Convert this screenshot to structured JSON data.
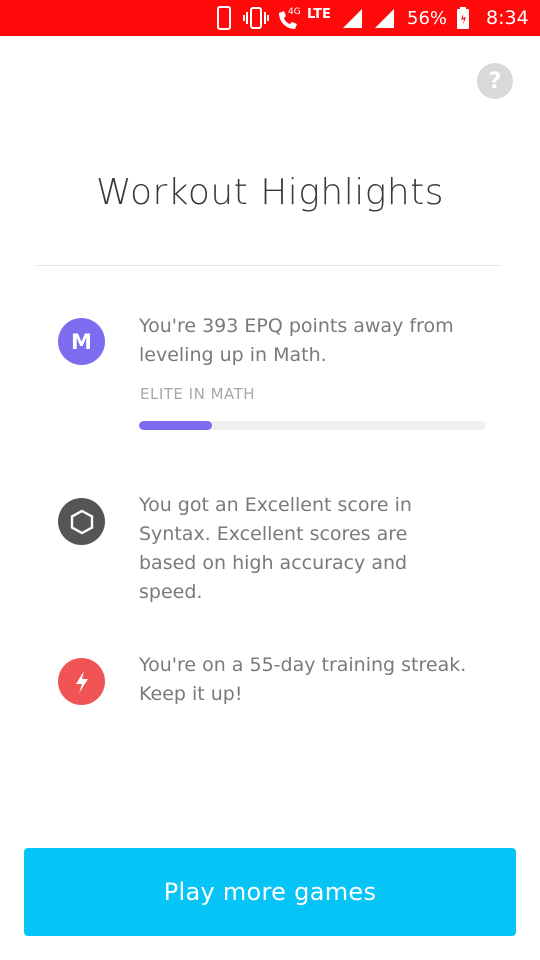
{
  "status_bar": {
    "lte": "LTE",
    "network_badge": "4G",
    "battery": "56%",
    "time": "8:34"
  },
  "help": {
    "icon": "question-icon",
    "label": "?"
  },
  "title": "Workout Highlights",
  "highlights": [
    {
      "icon_letter": "M",
      "icon_color": "#7b6cf0",
      "text": "You're 393 EPQ points away from leveling up in Math.",
      "label": "ELITE IN MATH",
      "progress": 0.21
    },
    {
      "icon": "hexagon-icon",
      "icon_color": "#555555",
      "text": "You got an Excellent score in Syntax. Excellent scores are based on high accuracy and speed."
    },
    {
      "icon": "lightning-icon",
      "icon_color": "#f05454",
      "text": "You're on a 55-day training streak. Keep it up!"
    }
  ],
  "cta": {
    "label": "Play more games",
    "color": "#07c4f6"
  },
  "colors": {
    "status_bar": "#ff0a0a"
  }
}
